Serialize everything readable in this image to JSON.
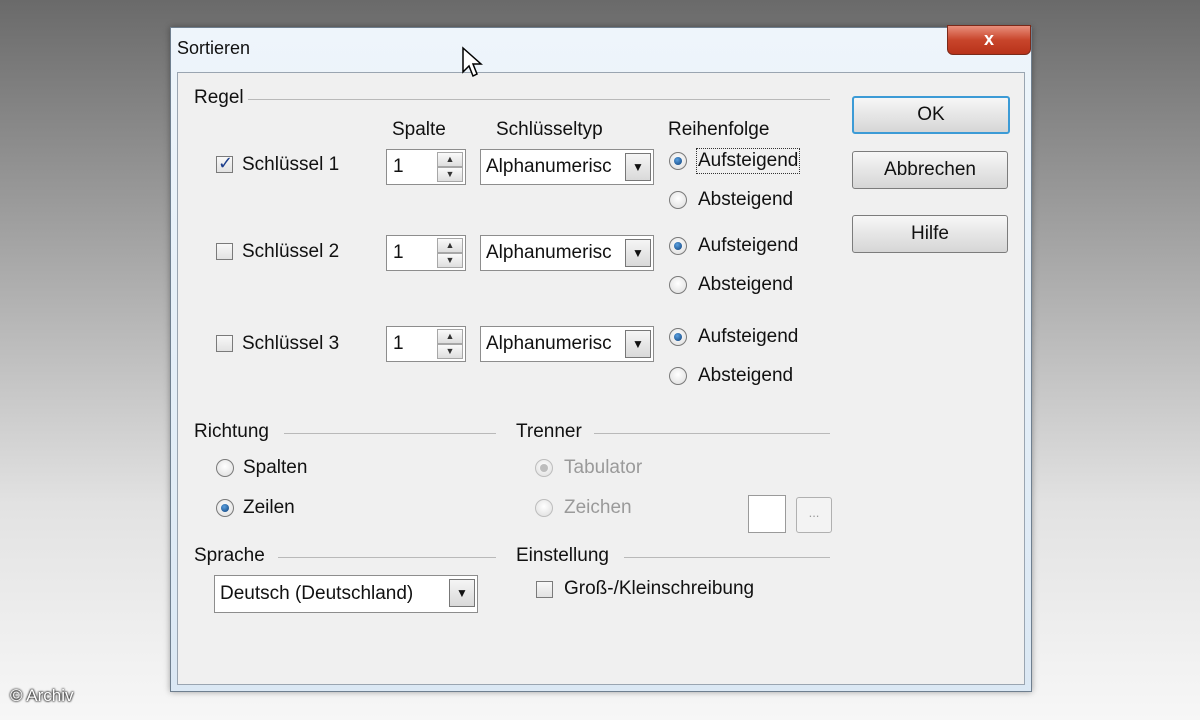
{
  "window": {
    "title": "Sortieren",
    "close_label": "x"
  },
  "regel": {
    "label": "Regel",
    "col_spalte": "Spalte",
    "col_typ": "Schlüsseltyp",
    "col_reihenfolge": "Reihenfolge",
    "keys": [
      {
        "label": "Schlüssel 1",
        "checked": true,
        "column": "1",
        "type": "Alphanumerisc",
        "asc": "Aufsteigend",
        "desc": "Absteigend",
        "selected": "asc"
      },
      {
        "label": "Schlüssel 2",
        "checked": false,
        "column": "1",
        "type": "Alphanumerisc",
        "asc": "Aufsteigend",
        "desc": "Absteigend",
        "selected": "asc"
      },
      {
        "label": "Schlüssel 3",
        "checked": false,
        "column": "1",
        "type": "Alphanumerisc",
        "asc": "Aufsteigend",
        "desc": "Absteigend",
        "selected": "asc"
      }
    ]
  },
  "richtung": {
    "label": "Richtung",
    "spalten": "Spalten",
    "zeilen": "Zeilen",
    "selected": "zeilen"
  },
  "trenner": {
    "label": "Trenner",
    "tabulator": "Tabulator",
    "zeichen": "Zeichen",
    "selected": "tabulator",
    "dots_label": "..."
  },
  "sprache": {
    "label": "Sprache",
    "value": "Deutsch (Deutschland)"
  },
  "einstellung": {
    "label": "Einstellung",
    "case_label": "Groß-/Kleinschreibung",
    "case_checked": false
  },
  "buttons": {
    "ok": "OK",
    "cancel": "Abbrechen",
    "help": "Hilfe"
  },
  "watermark": "© Archiv",
  "colors": {
    "accent": "#3c9bd6",
    "close": "#c8452b"
  }
}
